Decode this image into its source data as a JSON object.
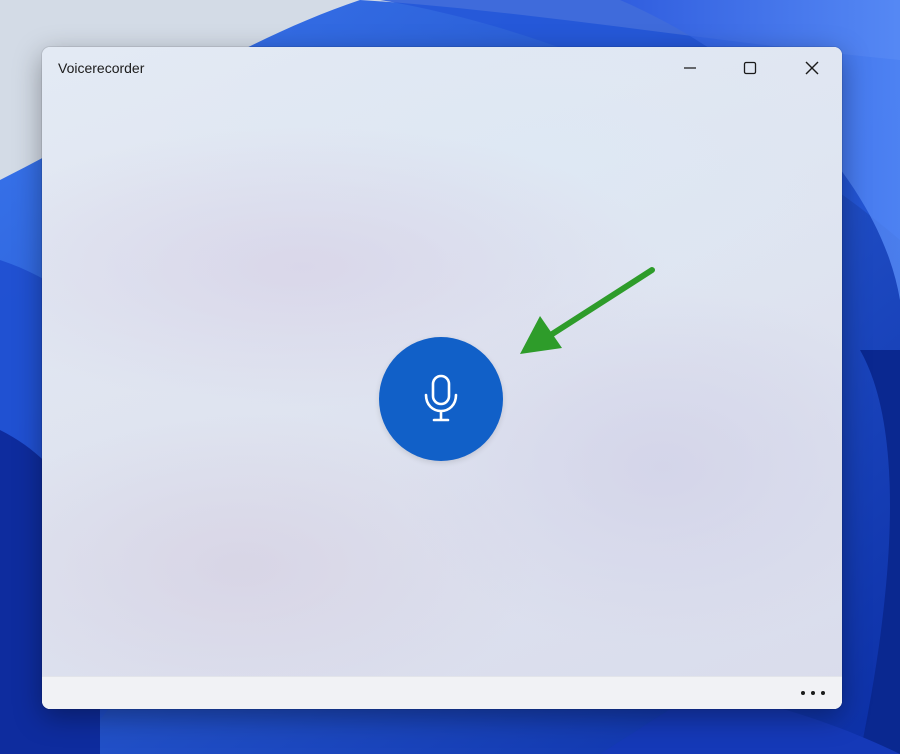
{
  "window": {
    "title": "Voicerecorder"
  },
  "titlebar": {
    "minimize_icon": "minimize-icon",
    "maximize_icon": "maximize-icon",
    "close_icon": "close-icon"
  },
  "main": {
    "record_icon": "microphone-icon",
    "accent_color": "#1160c8",
    "annotation_arrow_color": "#2e9c2a"
  },
  "bottombar": {
    "more_icon": "more-options-icon"
  }
}
